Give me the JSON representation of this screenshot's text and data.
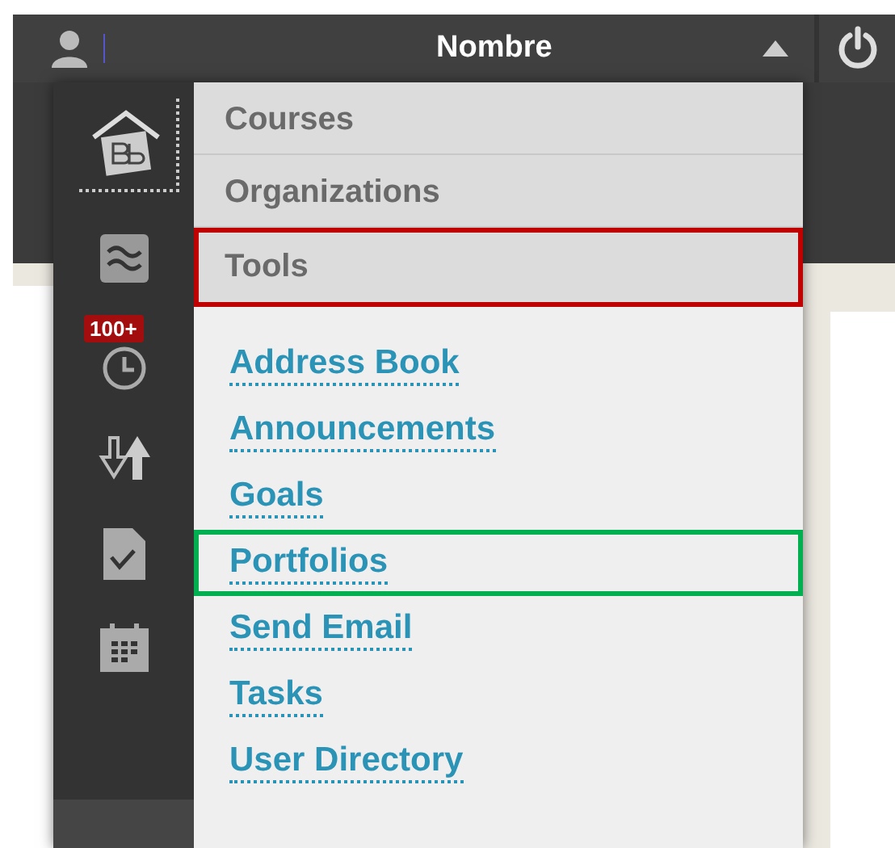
{
  "top_bar": {
    "user_name": "Nombre"
  },
  "sidebar": {
    "badge": "100+"
  },
  "menu": {
    "categories": [
      {
        "label": "Courses"
      },
      {
        "label": "Organizations"
      },
      {
        "label": "Tools",
        "color": "#c00000"
      }
    ],
    "links": [
      {
        "label": "Address Book"
      },
      {
        "label": "Announcements"
      },
      {
        "label": "Goals"
      },
      {
        "label": "Portfolios",
        "color": "#00b050"
      },
      {
        "label": "Send Email"
      },
      {
        "label": "Tasks"
      },
      {
        "label": "User Directory"
      }
    ]
  }
}
